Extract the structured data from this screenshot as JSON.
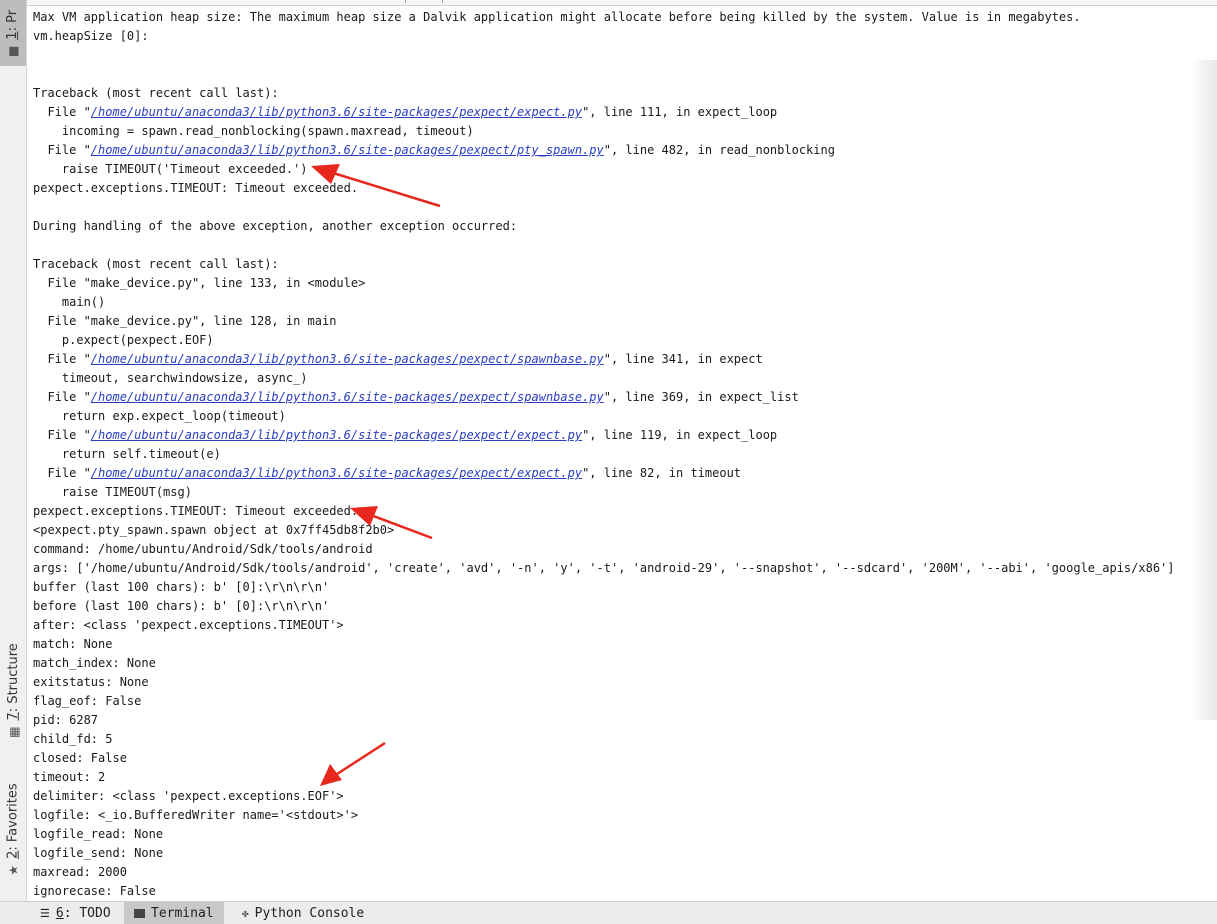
{
  "side_tabs": {
    "project": {
      "num": "1",
      "label": ": Pr"
    },
    "structure": {
      "num": "7",
      "label": ": Structure"
    },
    "favorites": {
      "num": "2",
      "label": ": Favorites"
    }
  },
  "console_lines": [
    {
      "text": "Max VM application heap size: The maximum heap size a Dalvik application might allocate before being killed by the system. Value is in megabytes."
    },
    {
      "text": "vm.heapSize [0]:"
    },
    {
      "text": ""
    },
    {
      "text": ""
    },
    {
      "text": "Traceback (most recent call last):"
    },
    {
      "pre": "  File \"",
      "link": "/home/ubuntu/anaconda3/lib/python3.6/site-packages/pexpect/expect.py",
      "post": "\", line 111, in expect_loop"
    },
    {
      "text": "    incoming = spawn.read_nonblocking(spawn.maxread, timeout)"
    },
    {
      "pre": "  File \"",
      "link": "/home/ubuntu/anaconda3/lib/python3.6/site-packages/pexpect/pty_spawn.py",
      "post": "\", line 482, in read_nonblocking"
    },
    {
      "text": "    raise TIMEOUT('Timeout exceeded.')"
    },
    {
      "text": "pexpect.exceptions.TIMEOUT: Timeout exceeded."
    },
    {
      "text": ""
    },
    {
      "text": "During handling of the above exception, another exception occurred:"
    },
    {
      "text": ""
    },
    {
      "text": "Traceback (most recent call last):"
    },
    {
      "text": "  File \"make_device.py\", line 133, in <module>"
    },
    {
      "text": "    main()"
    },
    {
      "text": "  File \"make_device.py\", line 128, in main"
    },
    {
      "text": "    p.expect(pexpect.EOF)"
    },
    {
      "pre": "  File \"",
      "link": "/home/ubuntu/anaconda3/lib/python3.6/site-packages/pexpect/spawnbase.py",
      "post": "\", line 341, in expect"
    },
    {
      "text": "    timeout, searchwindowsize, async_)"
    },
    {
      "pre": "  File \"",
      "link": "/home/ubuntu/anaconda3/lib/python3.6/site-packages/pexpect/spawnbase.py",
      "post": "\", line 369, in expect_list"
    },
    {
      "text": "    return exp.expect_loop(timeout)"
    },
    {
      "pre": "  File \"",
      "link": "/home/ubuntu/anaconda3/lib/python3.6/site-packages/pexpect/expect.py",
      "post": "\", line 119, in expect_loop"
    },
    {
      "text": "    return self.timeout(e)"
    },
    {
      "pre": "  File \"",
      "link": "/home/ubuntu/anaconda3/lib/python3.6/site-packages/pexpect/expect.py",
      "post": "\", line 82, in timeout"
    },
    {
      "text": "    raise TIMEOUT(msg)"
    },
    {
      "text": "pexpect.exceptions.TIMEOUT: Timeout exceeded."
    },
    {
      "text": "<pexpect.pty_spawn.spawn object at 0x7ff45db8f2b0>"
    },
    {
      "text": "command: /home/ubuntu/Android/Sdk/tools/android"
    },
    {
      "text": "args: ['/home/ubuntu/Android/Sdk/tools/android', 'create', 'avd', '-n', 'y', '-t', 'android-29', '--snapshot', '--sdcard', '200M', '--abi', 'google_apis/x86']"
    },
    {
      "text": "buffer (last 100 chars): b' [0]:\\r\\n\\r\\n'"
    },
    {
      "text": "before (last 100 chars): b' [0]:\\r\\n\\r\\n'"
    },
    {
      "text": "after: <class 'pexpect.exceptions.TIMEOUT'>"
    },
    {
      "text": "match: None"
    },
    {
      "text": "match_index: None"
    },
    {
      "text": "exitstatus: None"
    },
    {
      "text": "flag_eof: False"
    },
    {
      "text": "pid: 6287"
    },
    {
      "text": "child_fd: 5"
    },
    {
      "text": "closed: False"
    },
    {
      "text": "timeout: 2"
    },
    {
      "text": "delimiter: <class 'pexpect.exceptions.EOF'>"
    },
    {
      "text": "logfile: <_io.BufferedWriter name='<stdout>'>"
    },
    {
      "text": "logfile_read: None"
    },
    {
      "text": "logfile_send: None"
    },
    {
      "text": "maxread: 2000"
    },
    {
      "text": "ignorecase: False"
    }
  ],
  "bottom_tabs": [
    {
      "icon": "list-icon",
      "num": "6",
      "label": ": TODO"
    },
    {
      "icon": "terminal-icon",
      "num": "",
      "label": "Terminal"
    },
    {
      "icon": "python-console-icon",
      "num": "",
      "label": "Python Console"
    }
  ],
  "colors": {
    "link": "#2a3fbf",
    "arrow": "#e8281e"
  }
}
